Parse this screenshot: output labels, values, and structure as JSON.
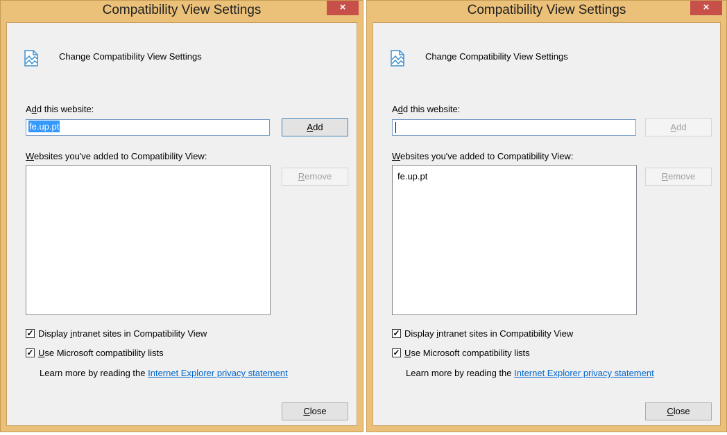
{
  "dialogs": [
    {
      "title": "Compatibility View Settings",
      "close_glyph": "×",
      "header": "Change Compatibility View Settings",
      "add_label_pre": "A",
      "add_label_u": "d",
      "add_label_post": "d this website:",
      "input_value": "fe.up.pt",
      "add_button_u": "A",
      "add_button_post": "dd",
      "list_label_u": "W",
      "list_label_post": "ebsites you've added to Compatibility View:",
      "remove_button_u": "R",
      "remove_button_post": "emove",
      "list_items": [],
      "intranet_pre": "Display ",
      "intranet_u": "i",
      "intranet_post": "ntranet sites in Compatibility View",
      "ms_u": "U",
      "ms_post": "se Microsoft compatibility lists",
      "learn_text": "Learn more by reading the ",
      "learn_link": "Internet Explorer privacy statement",
      "close_button_u": "C",
      "close_button_post": "lose"
    },
    {
      "title": "Compatibility View Settings",
      "close_glyph": "×",
      "header": "Change Compatibility View Settings",
      "add_label_pre": "A",
      "add_label_u": "d",
      "add_label_post": "d this website:",
      "input_value": "",
      "add_button_u": "A",
      "add_button_post": "dd",
      "list_label_u": "W",
      "list_label_post": "ebsites you've added to Compatibility View:",
      "remove_button_u": "R",
      "remove_button_post": "emove",
      "list_items": [
        "fe.up.pt"
      ],
      "intranet_pre": "Display ",
      "intranet_u": "i",
      "intranet_post": "ntranet sites in Compatibility View",
      "ms_u": "U",
      "ms_post": "se Microsoft compatibility lists",
      "learn_text": "Learn more by reading the ",
      "learn_link": "Internet Explorer privacy statement",
      "close_button_u": "C",
      "close_button_post": "lose"
    }
  ],
  "checkbox_glyph": "✓",
  "colors": {
    "frame": "#ebc17a",
    "close_x": "#c7504a",
    "link": "#0066cc",
    "selection": "#3399ff"
  }
}
